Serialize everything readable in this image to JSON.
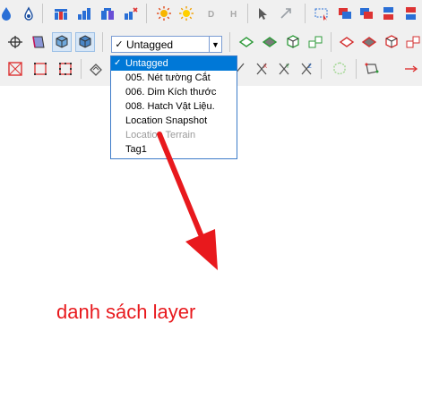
{
  "layer_combo": {
    "check": "✓",
    "value": "Untagged"
  },
  "layer_list": {
    "items": [
      {
        "label": "Untagged",
        "selected": true,
        "disabled": false
      },
      {
        "label": "005. Nét tường Cắt",
        "selected": false,
        "disabled": false
      },
      {
        "label": "006. Dim Kích thước",
        "selected": false,
        "disabled": false
      },
      {
        "label": "008. Hatch Vật Liệu.",
        "selected": false,
        "disabled": false
      },
      {
        "label": "Location Snapshot",
        "selected": false,
        "disabled": false
      },
      {
        "label": "Location Terrain",
        "selected": false,
        "disabled": true
      },
      {
        "label": "Tag1",
        "selected": false,
        "disabled": false
      }
    ]
  },
  "annotation": {
    "text": "danh sách layer",
    "color": "#e8191d"
  },
  "colors": {
    "accent_blue": "#0078d7",
    "arrow_red": "#e8191d"
  },
  "icons": {
    "row1": [
      "droplet-icon",
      "paint-bucket-icon",
      "bar-chart-icon",
      "bar-chart-icon",
      "bar-chart-icon",
      "bar-chart-icon",
      "sun-icon",
      "sun-icon",
      "d-icon",
      "h-icon",
      "cursor-icon",
      "resize-arrow-icon",
      "select-box-icon",
      "layers-icon",
      "layers-icon",
      "stack-icon",
      "stack-icon"
    ],
    "row2": [
      "axes-icon",
      "box-icon",
      "cube-icon",
      "cube-icon",
      "diamond-icon",
      "diamond-icon",
      "cube-outline-icon",
      "cubes-icon",
      "diamond-icon",
      "diamond-icon",
      "cube-icon",
      "cubes-icon"
    ],
    "row3": [
      "rect-cross-icon",
      "grid-icon",
      "grid-dots-icon",
      "eraser-icon",
      "x-icon",
      "x-icon",
      "x-icon",
      "x-icon",
      "cube-dashed-icon",
      "shape-icon",
      "arrow-icon"
    ]
  }
}
